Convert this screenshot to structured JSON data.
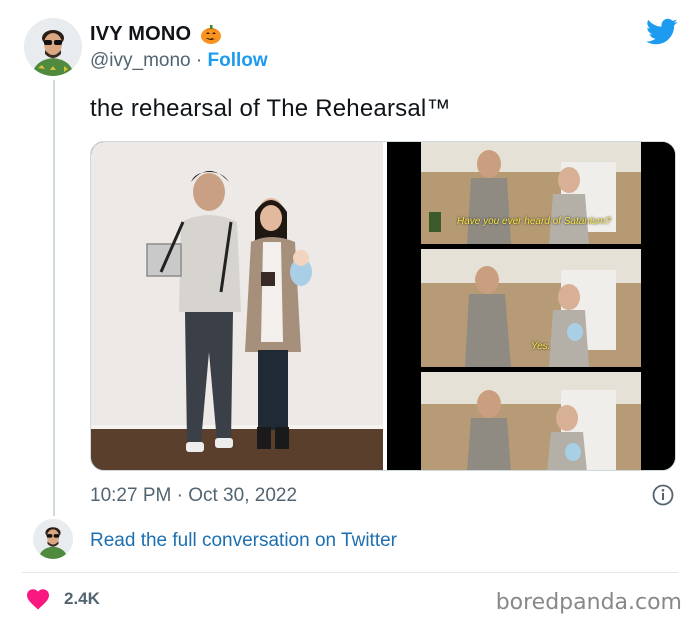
{
  "author": {
    "name": "IVY MONO",
    "name_emoji": "pumpkin-icon",
    "handle": "@ivy_mono",
    "separator": "·",
    "follow_label": "Follow"
  },
  "tweet": {
    "text": "the rehearsal of The Rehearsal™",
    "subtitle_1": "Have you ever heard of Satanism?",
    "subtitle_2": "Yes.",
    "time": "10:27 PM",
    "date_separator": "·",
    "date": "Oct 30, 2022"
  },
  "conversation": {
    "read_full_label": "Read the full conversation on Twitter"
  },
  "footer": {
    "likes": "2.4K",
    "watermark": "boredpanda.com"
  },
  "colors": {
    "twitter_blue": "#1d9bf0",
    "heart": "#f91880",
    "muted": "#536471"
  }
}
